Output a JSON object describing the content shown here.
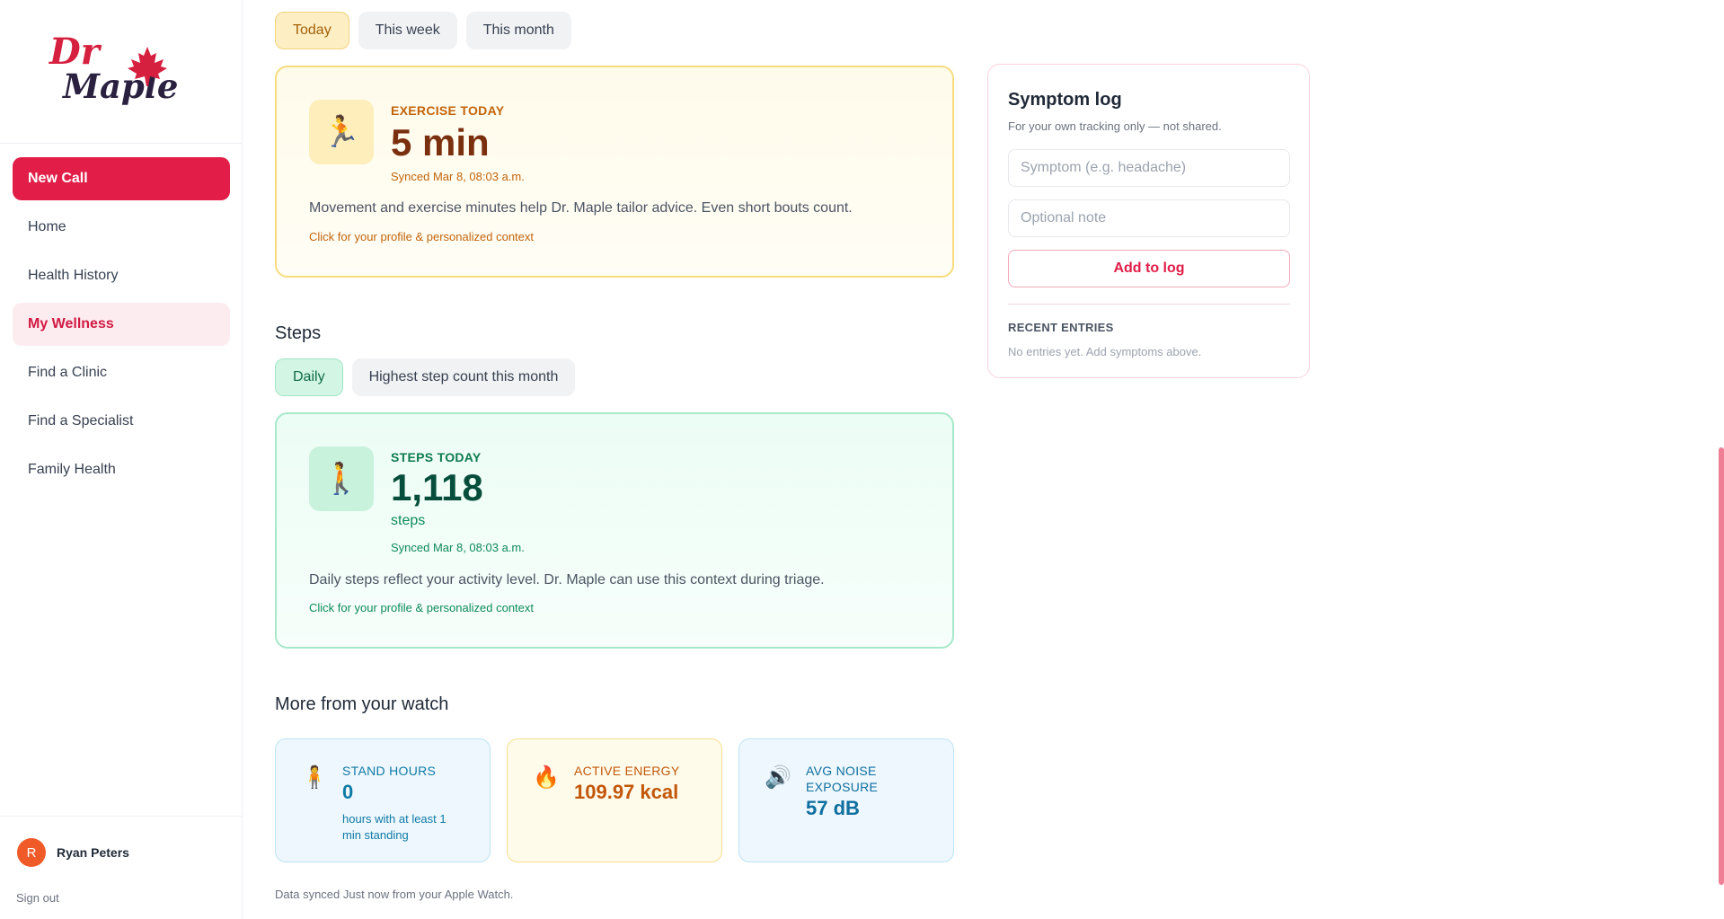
{
  "brand": {
    "line1": "Dr",
    "line2": "Maple"
  },
  "nav": {
    "items": [
      {
        "label": "New Call"
      },
      {
        "label": "Home"
      },
      {
        "label": "Health History"
      },
      {
        "label": "My Wellness"
      },
      {
        "label": "Find a Clinic"
      },
      {
        "label": "Find a Specialist"
      },
      {
        "label": "Family Health"
      }
    ]
  },
  "user": {
    "initial": "R",
    "name": "Ryan Peters",
    "signout": "Sign out"
  },
  "exercise": {
    "tabs": [
      "Today",
      "This week",
      "This month"
    ],
    "selected_tab": "Today",
    "kicker": "EXERCISE TODAY",
    "value": "5 min",
    "synced": "Synced Mar 8, 08:03 a.m.",
    "description": "Movement and exercise minutes help Dr. Maple tailor advice. Even short bouts count.",
    "link": "Click for your profile & personalized context",
    "icon": "running-person-icon"
  },
  "steps": {
    "title": "Steps",
    "tabs": [
      "Daily",
      "Highest step count this month"
    ],
    "selected_tab": "Daily",
    "kicker": "STEPS TODAY",
    "value": "1,118",
    "unit": "steps",
    "synced": "Synced Mar 8, 08:03 a.m.",
    "description": "Daily steps reflect your activity level. Dr. Maple can use this context during triage.",
    "link": "Click for your profile & personalized context",
    "icon": "walking-person-icon"
  },
  "watch": {
    "title": "More from your watch",
    "cards": [
      {
        "label": "STAND HOURS",
        "value": "0",
        "sub": "hours with at least 1 min standing",
        "icon": "standing-person-icon"
      },
      {
        "label": "ACTIVE ENERGY",
        "value": "109.97 kcal",
        "icon": "flame-icon"
      },
      {
        "label": "AVG NOISE EXPOSURE",
        "value": "57 dB",
        "icon": "speaker-icon"
      }
    ],
    "footnote": "Data synced Just now from your Apple Watch."
  },
  "symptom_log": {
    "title": "Symptom log",
    "subtitle": "For your own tracking only — not shared.",
    "symptom_placeholder": "Symptom (e.g. headache)",
    "note_placeholder": "Optional note",
    "add_label": "Add to log",
    "recent_heading": "RECENT ENTRIES",
    "recent_empty": "No entries yet. Add symptoms above."
  },
  "colors": {
    "brand_red": "#e11d48",
    "amber": "#c2640b",
    "green": "#0e7a4f",
    "blue": "#0e7aa6"
  }
}
